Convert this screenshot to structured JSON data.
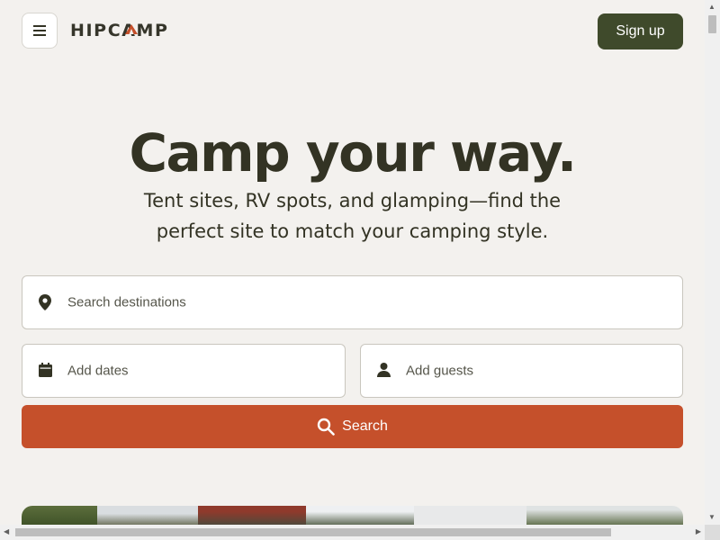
{
  "header": {
    "logo_text": "HIPCAMP",
    "signup_label": "Sign up",
    "menu_icon": "hamburger-icon"
  },
  "hero": {
    "title": "Camp your way.",
    "subtitle_line1": "Tent sites, RV spots, and glamping—find the",
    "subtitle_line2": "perfect site to match your camping style."
  },
  "search": {
    "destination_placeholder": "Search destinations",
    "dates_placeholder": "Add dates",
    "guests_placeholder": "Add guests",
    "button_label": "Search",
    "icons": [
      "map-pin-icon",
      "calendar-icon",
      "person-icon",
      "search-icon"
    ]
  },
  "colors": {
    "background": "#f3f1ee",
    "primary_dark": "#3f4a2b",
    "accent": "#c5502b",
    "text": "#333324"
  }
}
